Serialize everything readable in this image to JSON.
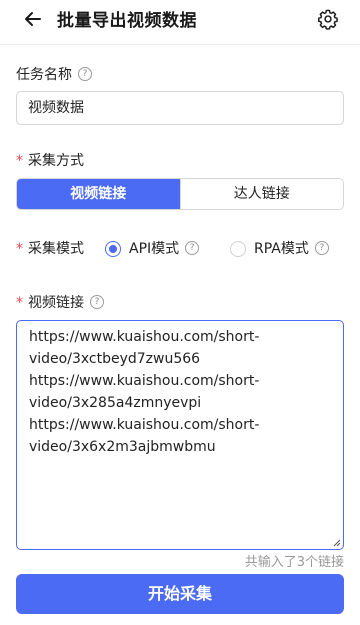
{
  "header": {
    "title": "批量导出视频数据",
    "back_icon": "arrow-left-icon",
    "settings_icon": "gear-icon"
  },
  "task_name": {
    "label": "任务名称",
    "help": "?",
    "value": "视频数据"
  },
  "collect_method": {
    "required_mark": "*",
    "label": "采集方式",
    "options": [
      {
        "label": "视频链接",
        "selected": true
      },
      {
        "label": "达人链接",
        "selected": false
      }
    ]
  },
  "collect_mode": {
    "required_mark": "*",
    "label": "采集模式",
    "options": [
      {
        "label": "API模式",
        "help": "?",
        "selected": true
      },
      {
        "label": "RPA模式",
        "help": "?",
        "selected": false
      }
    ]
  },
  "video_links": {
    "required_mark": "*",
    "label": "视频链接",
    "help": "?",
    "lines": [
      "https://www.kuaishou.com/short-",
      "video/3xctbeyd7zwu566",
      "https://www.kuaishou.com/short-",
      "video/3x285a4zmnyevpi",
      "https://www.kuaishou.com/short-",
      "video/3x6x2m3ajbmwbmu"
    ],
    "count_text": "共输入了3个链接"
  },
  "start_button": {
    "label": "开始采集"
  },
  "colors": {
    "accent": "#4b6bf5",
    "required": "#e5484d"
  }
}
